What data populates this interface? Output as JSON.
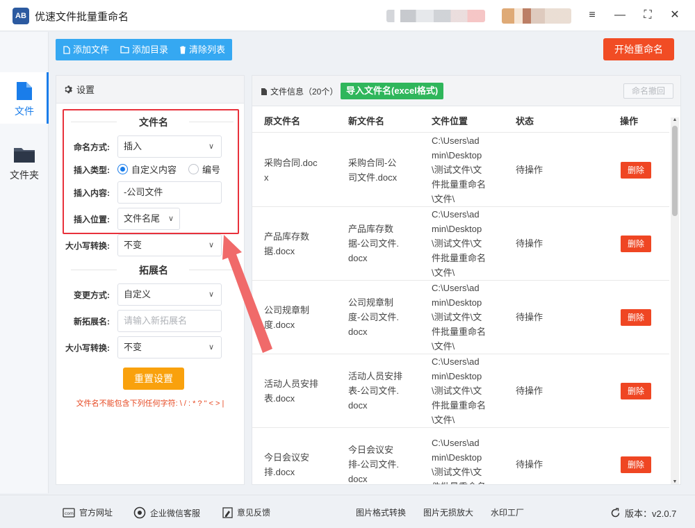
{
  "app": {
    "logo_text": "AB",
    "title": "优速文件批量重命名"
  },
  "window_controls": {
    "menu": "≡",
    "minimize": "—",
    "maximize": "⛶",
    "close": "✕"
  },
  "nav": [
    {
      "label": "文件",
      "icon": "file-icon",
      "active": true
    },
    {
      "label": "文件夹",
      "icon": "folder-icon",
      "active": false
    }
  ],
  "toolbar": {
    "add_file": "添加文件",
    "add_folder": "添加目录",
    "clear_list": "清除列表",
    "start": "开始重命名"
  },
  "settings": {
    "header": "设置",
    "filename_section": "文件名",
    "naming_mode_label": "命名方式:",
    "naming_mode_value": "插入",
    "insert_type_label": "插入类型:",
    "insert_type_options": [
      "自定义内容",
      "编号"
    ],
    "insert_content_label": "插入内容:",
    "insert_content_value": "-公司文件",
    "insert_position_label": "插入位置:",
    "insert_position_value": "文件名尾",
    "case_label": "大小写转换:",
    "case_value": "不变",
    "ext_section": "拓展名",
    "change_mode_label": "变更方式:",
    "change_mode_value": "自定义",
    "new_ext_label": "新拓展名:",
    "new_ext_placeholder": "请输入新拓展名",
    "ext_case_label": "大小写转换:",
    "ext_case_value": "不变",
    "reset_button": "重置设置",
    "warning": "文件名不能包含下列任何字符: \\ / : * ? \" < > |"
  },
  "files": {
    "info_label": "文件信息（20个）",
    "import_button": "导入文件名(excel格式)",
    "undo_button": "命名撤回",
    "columns": [
      "原文件名",
      "新文件名",
      "文件位置",
      "状态",
      "操作"
    ],
    "rows": [
      {
        "orig": [
          "采购合同.doc",
          "x"
        ],
        "new": [
          "采购合同-公",
          "司文件.docx"
        ],
        "path": [
          "C:\\Users\\ad",
          "min\\Desktop",
          "\\测试文件\\文",
          "件批量重命名",
          "\\文件\\"
        ],
        "status": "待操作",
        "action": "删除"
      },
      {
        "orig": [
          "产品库存数",
          "据.docx"
        ],
        "new": [
          "产品库存数",
          "据-公司文件.",
          "docx"
        ],
        "path": [
          "C:\\Users\\ad",
          "min\\Desktop",
          "\\测试文件\\文",
          "件批量重命名",
          "\\文件\\"
        ],
        "status": "待操作",
        "action": "删除"
      },
      {
        "orig": [
          "公司规章制",
          "度.docx"
        ],
        "new": [
          "公司规章制",
          "度-公司文件.",
          "docx"
        ],
        "path": [
          "C:\\Users\\ad",
          "min\\Desktop",
          "\\测试文件\\文",
          "件批量重命名",
          "\\文件\\"
        ],
        "status": "待操作",
        "action": "删除"
      },
      {
        "orig": [
          "活动人员安排",
          "表.docx"
        ],
        "new": [
          "活动人员安排",
          "表-公司文件.",
          "docx"
        ],
        "path": [
          "C:\\Users\\ad",
          "min\\Desktop",
          "\\测试文件\\文",
          "件批量重命名",
          "\\文件\\"
        ],
        "status": "待操作",
        "action": "删除"
      },
      {
        "orig": [
          "今日会议安",
          "排.docx"
        ],
        "new": [
          "今日会议安",
          "排-公司文件.",
          "docx"
        ],
        "path": [
          "C:\\Users\\ad",
          "min\\Desktop",
          "\\测试文件\\文",
          "件批量重命名"
        ],
        "status": "待操作",
        "action": "删除"
      }
    ]
  },
  "footer": {
    "website": "官方网址",
    "wechat": "企业微信客服",
    "feedback": "意见反馈",
    "image_convert": "图片格式转换",
    "image_enlarge": "图片无损放大",
    "watermark": "水印工厂",
    "version": "版本：v2.0.7"
  },
  "colors": {
    "primary": "#1a7dea",
    "toolbar": "#35a8f2",
    "start": "#f14c24",
    "import": "#2fb65b",
    "reset": "#f9a10d",
    "delete": "#ef4623",
    "highlight": "#e8313b"
  }
}
